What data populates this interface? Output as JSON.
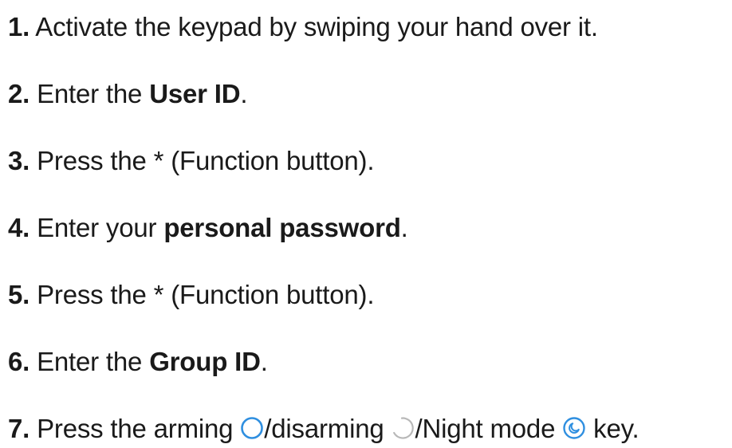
{
  "steps": [
    {
      "num": "1.",
      "text": " Activate the keypad by swiping your hand over it."
    },
    {
      "num": "2.",
      "pre": " Enter the ",
      "bold": "User ID",
      "post": "."
    },
    {
      "num": "3.",
      "text": " Press the * (Function button)."
    },
    {
      "num": "4.",
      "pre": " Enter your ",
      "bold": "personal password",
      "post": "."
    },
    {
      "num": "5.",
      "text": " Press the * (Function button)."
    },
    {
      "num": "6.",
      "pre": " Enter the ",
      "bold": "Group ID",
      "post": "."
    },
    {
      "num": "7.",
      "pre": " Press the arming ",
      "mid1": "/disarming ",
      "mid2": "/Night mode ",
      "post": " key."
    }
  ],
  "colors": {
    "text": "#1a1a1a",
    "icon_accent": "#2f8fe0",
    "icon_muted": "#b8b8b8"
  },
  "icons": [
    "arming-icon",
    "disarming-icon",
    "night-mode-icon"
  ]
}
